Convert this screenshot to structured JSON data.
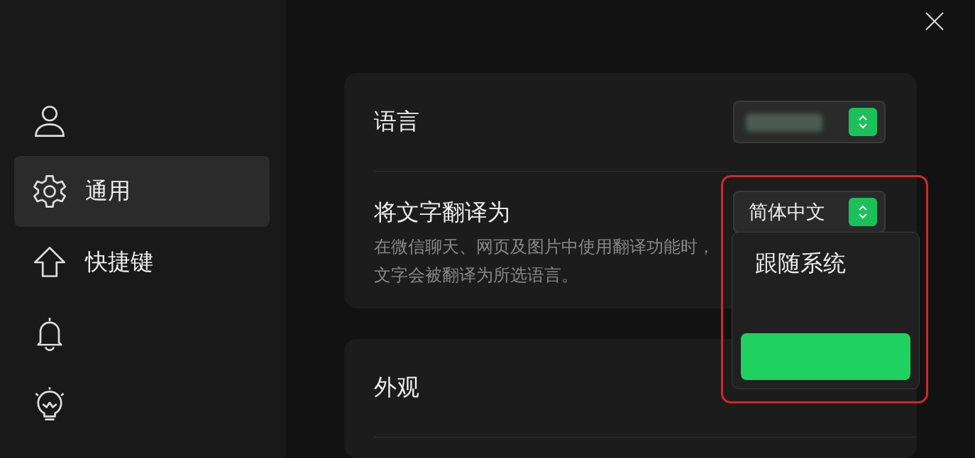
{
  "sidebar": {
    "items": [
      {
        "selected": false
      },
      {
        "label": "通用",
        "selected": true
      },
      {
        "label": "快捷键",
        "selected": false
      },
      {
        "selected": false
      },
      {
        "selected": false
      }
    ]
  },
  "settings": [
    {
      "title": "语言",
      "select": {
        "value_blurred": true
      }
    },
    {
      "title": "将文字翻译为",
      "description": "在微信聊天、网页及图片中使用翻译功能时，文字会被翻译为所选语言。",
      "select": {
        "value": "简体中文",
        "expanded": true,
        "options": [
          {
            "label": "跟随系统",
            "selected": false
          },
          {
            "selected": true
          }
        ]
      }
    }
  ],
  "appearance": {
    "title": "外观"
  }
}
